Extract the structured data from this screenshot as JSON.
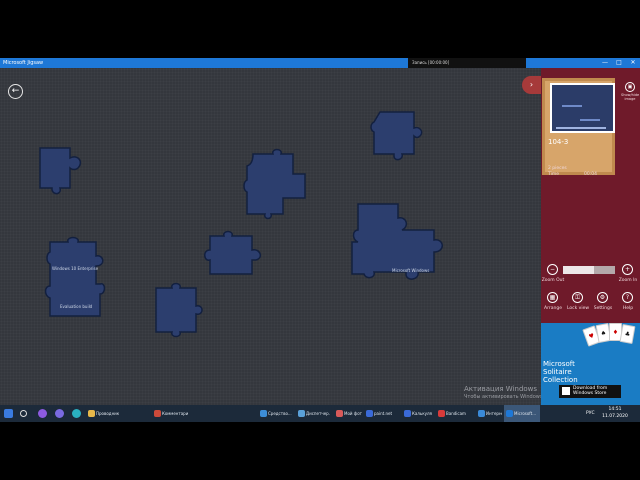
{
  "window": {
    "title": "Microsoft Jigsaw",
    "controls": [
      "—",
      "□",
      "✕"
    ]
  },
  "ext_toolbar": {
    "text": "Запись [00:00:00]"
  },
  "board": {
    "back_icon": "arrow-left-icon",
    "piece_captions": {
      "wide_piece": "Microsoft Windows",
      "left_piece_a": "Windows 10 Enterprise",
      "left_piece_b": "Evaluation build"
    }
  },
  "watermark": {
    "line1": "Активация Windows",
    "line2": "Чтобы активировать Windows, перейдите в раздел"
  },
  "panel": {
    "show_image_label": "Show/hide image",
    "puzzle_name": "104-3",
    "pieces_label": "2 pieces",
    "time_label": "Time",
    "time_value": "00:04",
    "zoom_level": 0.6,
    "zoom_out_label": "Zoom Out",
    "zoom_in_label": "Zoom In",
    "buttons": [
      {
        "label": "Arrange",
        "icon": "grid-icon"
      },
      {
        "label": "Lock view",
        "icon": "lock-icon"
      },
      {
        "label": "Settings",
        "icon": "gear-icon"
      },
      {
        "label": "Help",
        "icon": "help-icon"
      }
    ]
  },
  "ad": {
    "title": "Microsoft Solitaire Collection",
    "store_line1": "Download from",
    "store_line2": "Windows Store"
  },
  "taskbar": {
    "items": [
      {
        "label": "Проводник",
        "color": "#e8b84a"
      },
      {
        "label": "Комментарии",
        "color": "#cc4a3a"
      },
      {
        "label": "Средство...",
        "color": "#3d8ed8"
      },
      {
        "label": "Диспетчер...",
        "color": "#5aa0d8"
      },
      {
        "label": "Мой фото...",
        "color": "#d85a5a"
      },
      {
        "label": "paint.net",
        "color": "#3a6ad8"
      },
      {
        "label": "Калькулят...",
        "color": "#3a6ad8"
      },
      {
        "label": "Bandicam",
        "color": "#d83a3a"
      },
      {
        "label": "Интернет",
        "color": "#3a8ad8"
      },
      {
        "label": "Microsoft...",
        "color": "#1e78d7"
      }
    ],
    "lang": "РУС",
    "time": "14:51",
    "date": "11.07.2020"
  }
}
